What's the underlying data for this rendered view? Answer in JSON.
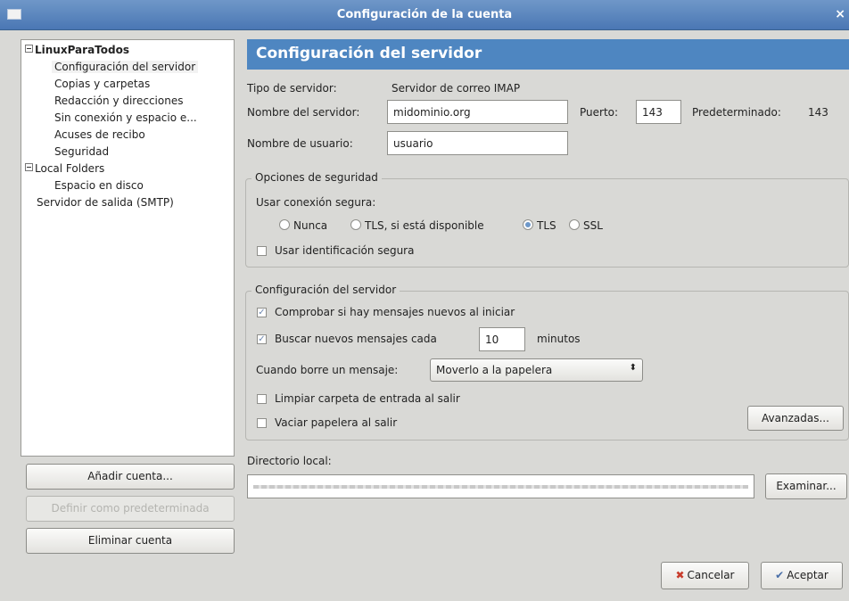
{
  "window": {
    "title": "Configuración de la cuenta",
    "close_glyph": "×"
  },
  "sidebar": {
    "account_name": "LinuxParaTodos",
    "account_items": [
      "Configuración del servidor",
      "Copias y carpetas",
      "Redacción y direcciones",
      "Sin conexión y espacio e...",
      "Acuses de recibo",
      "Seguridad"
    ],
    "local_folders": "Local Folders",
    "local_items": [
      "Espacio en disco"
    ],
    "smtp": "Servidor de salida (SMTP)",
    "add_account": "Añadir cuenta...",
    "set_default": "Definir como predeterminada",
    "remove_account": "Eliminar cuenta"
  },
  "server": {
    "heading": "Configuración del servidor",
    "type_label": "Tipo de servidor:",
    "type_value": "Servidor de correo IMAP",
    "name_label": "Nombre del servidor:",
    "name_value": "midominio.org",
    "port_label": "Puerto:",
    "port_value": "143",
    "default_label": "Predeterminado:",
    "default_value": "143",
    "user_label": "Nombre de usuario:",
    "user_value": "usuario"
  },
  "security": {
    "frame_title": "Opciones de seguridad",
    "secure_label": "Usar conexión segura:",
    "options": [
      "Nunca",
      "TLS, si está disponible",
      "TLS",
      "SSL"
    ],
    "selected": "TLS",
    "secure_auth": "Usar identificación segura",
    "secure_auth_checked": false
  },
  "server_settings": {
    "frame_title": "Configuración del servidor",
    "check_startup": "Comprobar si hay mensajes nuevos al iniciar",
    "check_startup_checked": true,
    "check_every": "Buscar nuevos mensajes cada",
    "check_every_checked": true,
    "minutes_value": "10",
    "minutes_label": "minutos",
    "delete_label": "Cuando borre un mensaje:",
    "delete_option": "Moverlo a la papelera",
    "clean_inbox": "Limpiar carpeta de entrada al salir",
    "clean_inbox_checked": false,
    "empty_trash": "Vaciar papelera al salir",
    "empty_trash_checked": false,
    "advanced": "Avanzadas..."
  },
  "local_dir": {
    "label": "Directorio local:",
    "browse": "Examinar..."
  },
  "footer": {
    "cancel": "Cancelar",
    "ok": "Aceptar"
  },
  "icons": {
    "check_glyph": "✓",
    "cancel_glyph": "✖",
    "ok_glyph": "✔",
    "select_arrows": "⬍"
  }
}
